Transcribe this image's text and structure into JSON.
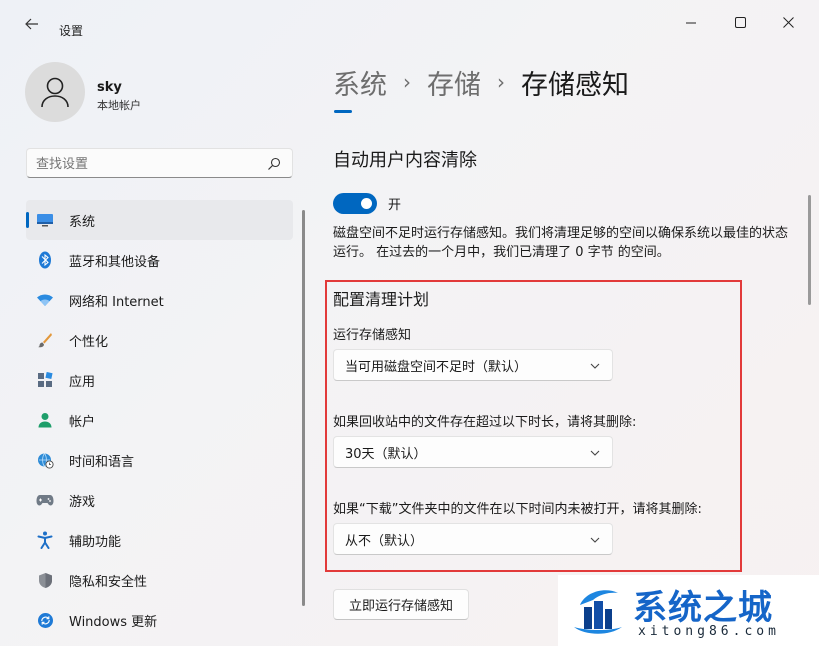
{
  "window": {
    "app_title": "设置",
    "controls": {
      "minimize_icon": "minimize-icon",
      "maximize_icon": "maximize-icon",
      "close_icon": "close-icon"
    }
  },
  "profile": {
    "name": "sky",
    "account_type": "本地帐户"
  },
  "search": {
    "placeholder": "查找设置"
  },
  "sidebar": {
    "items": [
      {
        "label": "系统",
        "icon": "display-icon",
        "active": true
      },
      {
        "label": "蓝牙和其他设备",
        "icon": "bluetooth-icon"
      },
      {
        "label": "网络和 Internet",
        "icon": "wifi-icon"
      },
      {
        "label": "个性化",
        "icon": "brush-icon"
      },
      {
        "label": "应用",
        "icon": "apps-icon"
      },
      {
        "label": "帐户",
        "icon": "person-icon"
      },
      {
        "label": "时间和语言",
        "icon": "globe-clock-icon"
      },
      {
        "label": "游戏",
        "icon": "gamepad-icon"
      },
      {
        "label": "辅助功能",
        "icon": "accessibility-icon"
      },
      {
        "label": "隐私和安全性",
        "icon": "shield-icon"
      },
      {
        "label": "Windows 更新",
        "icon": "update-icon"
      }
    ]
  },
  "breadcrumb": {
    "parts": [
      "系统",
      "存储"
    ],
    "current": "存储感知"
  },
  "main": {
    "section_title": "自动用户内容清除",
    "toggle_label": "开",
    "toggle_on": true,
    "description": "磁盘空间不足时运行存储感知。我们将清理足够的空间以确保系统以最佳的状态运行。 在过去的一个月中，我们已清理了 0 字节 的空间。",
    "schedule_title": "配置清理计划",
    "fields": [
      {
        "label": "运行存储感知",
        "value": "当可用磁盘空间不足时（默认）"
      },
      {
        "label": "如果回收站中的文件存在超过以下时长，请将其删除:",
        "value": "30天（默认）"
      },
      {
        "label": "如果“下载”文件夹中的文件在以下时间内未被打开，请将其删除:",
        "value": "从不（默认）"
      }
    ],
    "run_button": "立即运行存储感知"
  },
  "watermark": {
    "title": "系统之城",
    "subtitle": "xitong86.com"
  },
  "colors": {
    "accent": "#0067c0",
    "highlight": "#e23a3a",
    "watermark": "#1565c8"
  }
}
